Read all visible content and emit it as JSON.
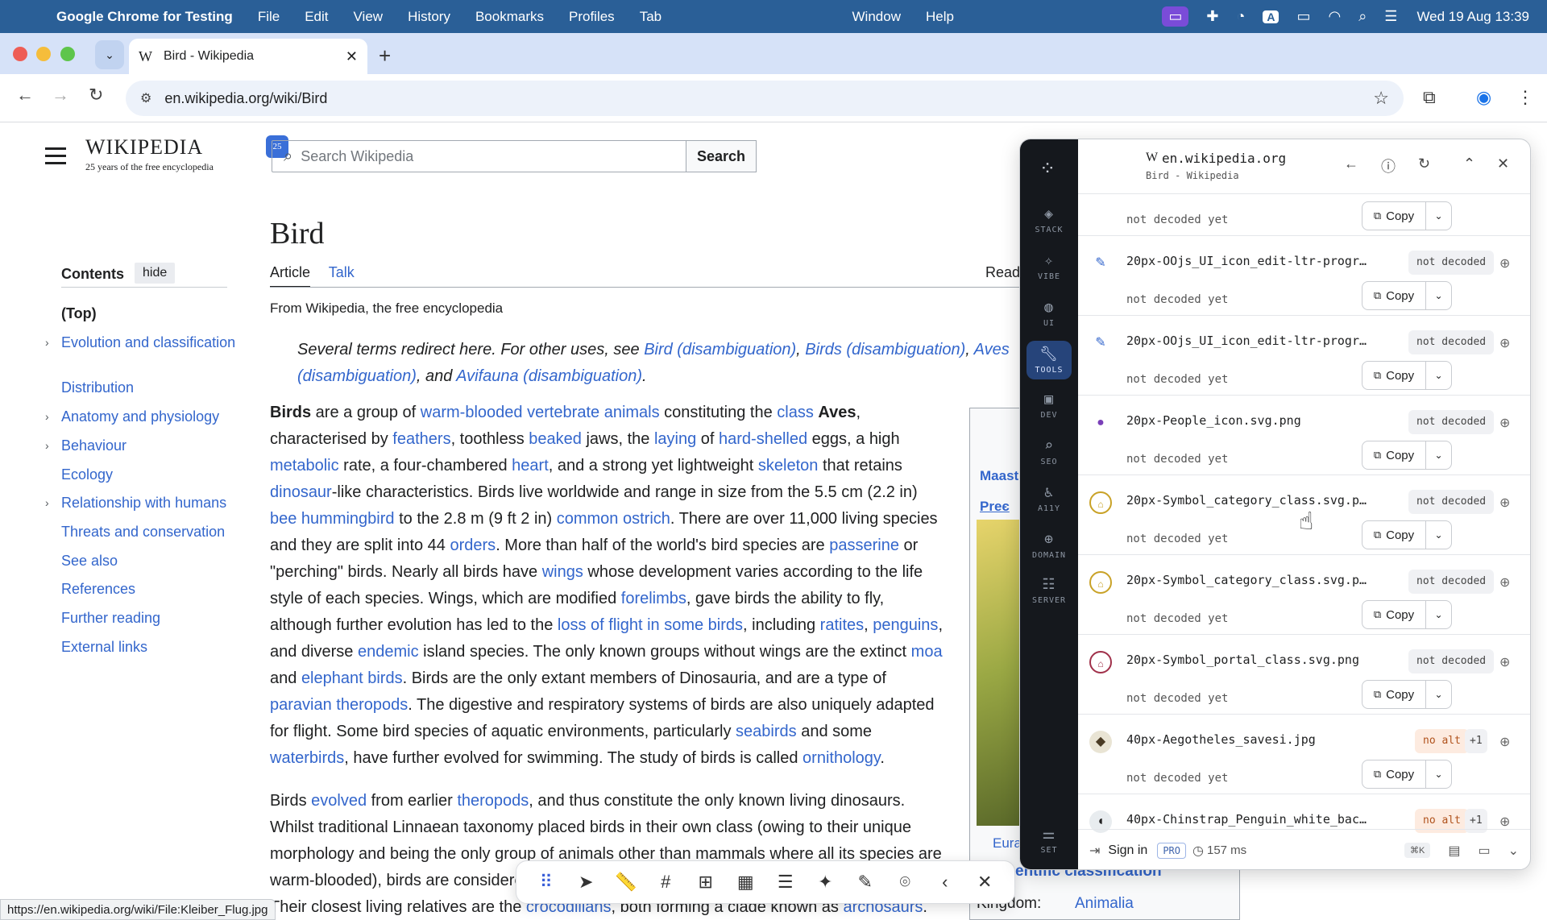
{
  "menubar": {
    "app": "Google Chrome for Testing",
    "items": [
      "File",
      "Edit",
      "View",
      "History",
      "Bookmarks",
      "Profiles",
      "Tab"
    ],
    "right_items": [
      "Window",
      "Help"
    ],
    "clock": "Wed 19 Aug  13:39"
  },
  "browser": {
    "tab_title": "Bird - Wikipedia",
    "url": "en.wikipedia.org/wiki/Bird"
  },
  "wiki": {
    "logo_title": "Wikipedia",
    "logo_sub": "25 years of the free encyclopedia",
    "search_placeholder": "Search Wikipedia",
    "search_button": "Search",
    "page_title": "Bird",
    "tab_article": "Article",
    "tab_talk": "Talk",
    "tab_read": "Read",
    "from": "From Wikipedia, the free encyclopedia",
    "toc_title": "Contents",
    "toc_hide": "hide",
    "toc_top": "(Top)",
    "toc": [
      "Evolution and classification",
      "Distribution",
      "Anatomy and physiology",
      "Behaviour",
      "Ecology",
      "Relationship with humans",
      "Threats and conservation",
      "See also",
      "References",
      "Further reading",
      "External links"
    ],
    "infobox_top": "Maast",
    "infobox_top2": "Preє",
    "infobox_caption": "Eura",
    "infobox_class": "entific classification",
    "kingdom_label": "Kingdom:",
    "kingdom_value": "Animalia",
    "status_url": "https://en.wikipedia.org/wiki/File:Kleiber_Flug.jpg"
  },
  "panel": {
    "domain": "en.wikipedia.org",
    "subtitle": "Bird - Wikipedia",
    "rail": [
      "STACK",
      "VIBE",
      "UI",
      "TOOLS",
      "DEV",
      "SEO",
      "A11Y",
      "DOMAIN",
      "SERVER",
      "SET"
    ],
    "not_decoded_yet": "not decoded yet",
    "copy": "Copy",
    "rows": [
      {
        "name": "",
        "badge": "",
        "extra": ""
      },
      {
        "name": "20px-OOjs_UI_icon_edit-ltr-progr…",
        "badge": "not decoded",
        "extra": ""
      },
      {
        "name": "20px-OOjs_UI_icon_edit-ltr-progr…",
        "badge": "not decoded",
        "extra": ""
      },
      {
        "name": "20px-People_icon.svg.png",
        "badge": "not decoded",
        "extra": ""
      },
      {
        "name": "20px-Symbol_category_class.svg.p…",
        "badge": "not decoded",
        "extra": ""
      },
      {
        "name": "20px-Symbol_category_class.svg.p…",
        "badge": "not decoded",
        "extra": ""
      },
      {
        "name": "20px-Symbol_portal_class.svg.png",
        "badge": "not decoded",
        "extra": ""
      },
      {
        "name": "40px-Aegotheles_savesi.jpg",
        "badge": "no alt",
        "extra": "+1"
      },
      {
        "name": "40px-Chinstrap_Penguin_white_bac…",
        "badge": "no alt",
        "extra": "+1"
      }
    ],
    "sign_in": "Sign in",
    "pro": "PRO",
    "ms": "157 ms",
    "kbd": "⌘K"
  }
}
